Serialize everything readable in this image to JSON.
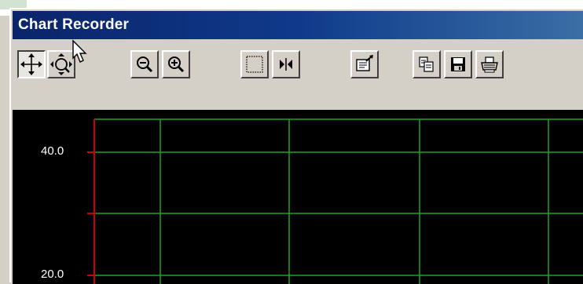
{
  "window": {
    "title": "Chart Recorder"
  },
  "toolbar": {
    "buttons": [
      {
        "id": "pan",
        "icon": "move-arrows-icon",
        "pressed": true
      },
      {
        "id": "zoom-region",
        "icon": "zoom-region-icon",
        "pressed": false
      },
      {
        "id": "zoom-out",
        "icon": "zoom-out-icon",
        "pressed": false
      },
      {
        "id": "zoom-in",
        "icon": "zoom-in-icon",
        "pressed": false
      },
      {
        "id": "select-box",
        "icon": "dotted-rectangle-icon",
        "pressed": false
      },
      {
        "id": "split",
        "icon": "split-arrows-icon",
        "pressed": false
      },
      {
        "id": "properties",
        "icon": "properties-icon",
        "pressed": false
      },
      {
        "id": "copy",
        "icon": "copy-icon",
        "pressed": false
      },
      {
        "id": "save",
        "icon": "floppy-disk-icon",
        "pressed": false
      },
      {
        "id": "print",
        "icon": "printer-icon",
        "pressed": false
      }
    ]
  },
  "chart": {
    "y_labels": [
      "40.0",
      "20.0"
    ],
    "colors": {
      "background": "#000000",
      "grid": "#1aa51a",
      "axis": "#cc0000",
      "label": "#ffffff"
    }
  }
}
